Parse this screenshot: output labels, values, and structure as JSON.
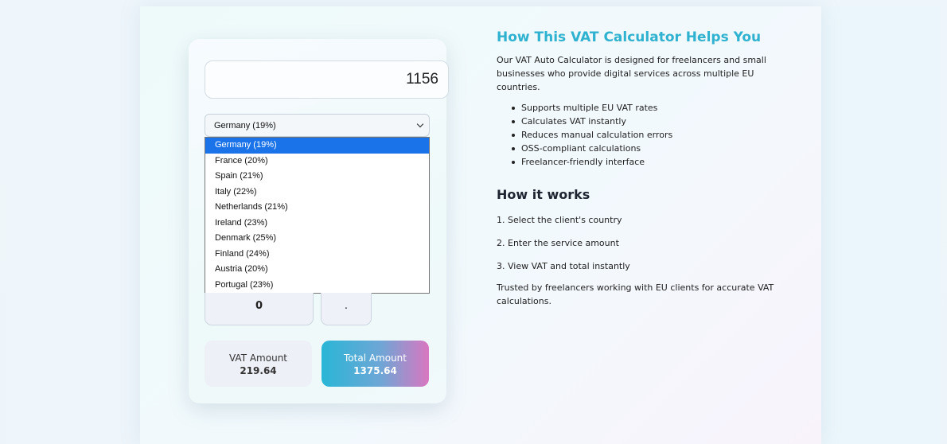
{
  "calculator": {
    "amount": "1156",
    "selected_country": "Germany (19%)",
    "countries": [
      "Germany (19%)",
      "France (20%)",
      "Spain (21%)",
      "Italy (22%)",
      "Netherlands (21%)",
      "Ireland (23%)",
      "Denmark (25%)",
      "Finland (24%)",
      "Austria (20%)",
      "Portugal (23%)"
    ],
    "key_zero": "0",
    "key_dot": ".",
    "vat_label": "VAT Amount",
    "vat_value": "219.64",
    "total_label": "Total Amount",
    "total_value": "1375.64"
  },
  "info": {
    "title": "How This VAT Calculator Helps You",
    "intro": "Our VAT Auto Calculator is designed for freelancers and small businesses who provide digital services across multiple EU countries.",
    "features": [
      "Supports multiple EU VAT rates",
      "Calculates VAT instantly",
      "Reduces manual calculation errors",
      "OSS-compliant calculations",
      "Freelancer-friendly interface"
    ],
    "how_title": "How it works",
    "steps": [
      "1. Select the client's country",
      "2. Enter the service amount",
      "3. View VAT and total instantly"
    ],
    "trust": "Trusted by freelancers working with EU clients for accurate VAT calculations."
  },
  "colors": {
    "accent": "#2fb2cf",
    "selected_option": "#1a73e8",
    "total_gradient_start": "#29b6d6",
    "total_gradient_end": "#d977c0"
  }
}
